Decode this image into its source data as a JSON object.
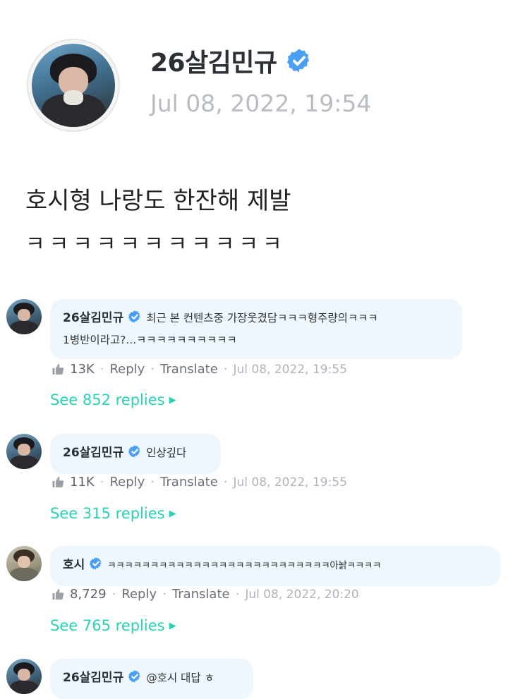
{
  "post": {
    "author": "26살김민규",
    "date": "Jul 08, 2022, 19:54",
    "body_line1": "호시형 나랑도 한잔해 제발",
    "body_line2": "ㅋㅋㅋㅋㅋㅋㅋㅋㅋㅋㅋ"
  },
  "colors": {
    "verified": "#4a9ff5",
    "accent": "#2bd1b6",
    "bubble": "#eef7fe"
  },
  "comments": [
    {
      "name": "26살김민규",
      "text_line1": "최근 본 컨텐츠중 가장웃겼담ㅋㅋㅋ형주량의ㅋㅋㅋ",
      "text_line2": "1병반이라고?...ㅋㅋㅋㅋㅋㅋㅋㅋㅋㅋ",
      "likes": "13K",
      "reply": "Reply",
      "translate": "Translate",
      "date": "Jul 08, 2022, 19:55",
      "see_replies": "See 852 replies"
    },
    {
      "name": "26살김민규",
      "text_line1": "인상깊다",
      "likes": "11K",
      "reply": "Reply",
      "translate": "Translate",
      "date": "Jul 08, 2022, 19:55",
      "see_replies": "See 315 replies"
    },
    {
      "name": "호시",
      "text_line1": "ㅋㅋㅋㅋㅋㅋㅋㅋㅋㅋㅋㅋㅋㅋㅋㅋㅋㅋㅋㅋㅋㅋㅋㅋㅋㅋ아놝ㅋㅋㅋㅋ",
      "likes": "8,729",
      "reply": "Reply",
      "translate": "Translate",
      "date": "Jul 08, 2022, 20:20",
      "see_replies": "See 765 replies"
    },
    {
      "name": "26살김민규",
      "text_line1": "@호시 대답 ㅎ"
    }
  ]
}
